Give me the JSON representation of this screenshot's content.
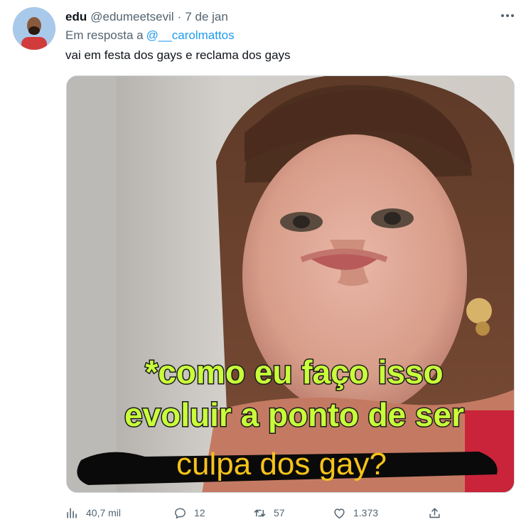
{
  "tweet": {
    "author_name": "edu",
    "author_handle": "@edumeetsevil",
    "separator": "·",
    "date": "7 de jan",
    "reply_prefix": "Em resposta a",
    "reply_mention": "@__carolmattos",
    "text": "vai em festa dos gays e reclama dos gays",
    "media": {
      "caption_line1": "*como eu faço isso",
      "caption_line2": "evoluir a ponto de ser",
      "overlay_text": "culpa dos gay?"
    },
    "actions": {
      "views_count": "40,7 mil",
      "reply_count": "12",
      "retweet_count": "57",
      "like_count": "1.373"
    }
  },
  "colors": {
    "text_primary": "#0f1419",
    "text_secondary": "#536471",
    "link": "#1d9bf0",
    "caption_fill": "#c8ff3a",
    "overlay_text": "#f6c21b"
  },
  "icons": {
    "more": "more-icon",
    "views": "views-icon",
    "reply": "reply-icon",
    "retweet": "retweet-icon",
    "like": "heart-icon",
    "share": "share-icon"
  }
}
